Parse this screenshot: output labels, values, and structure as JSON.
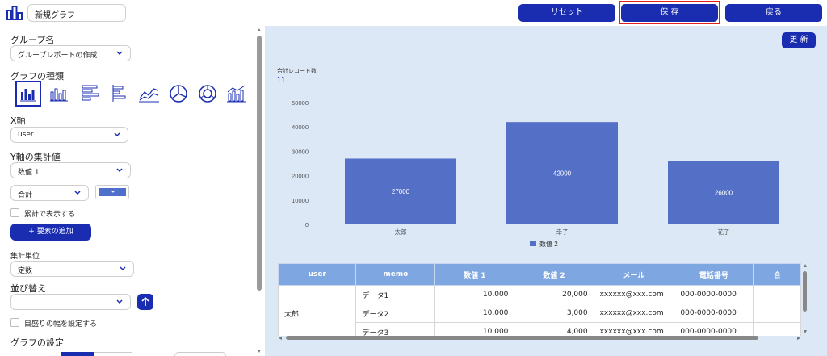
{
  "header": {
    "title_value": "新規グラフ",
    "reset_label": "リセット",
    "save_label": "保 存",
    "back_label": "戻る"
  },
  "sidebar": {
    "group_name_label": "グループ名",
    "group_select_value": "グループレポートの作成",
    "chart_type_label": "グラフの種類",
    "chart_types": [
      "bar-vertical-icon",
      "bar-vertical-thin-icon",
      "bar-horizontal-icon",
      "bar-horizontal-thin-icon",
      "line-chart-icon",
      "pie-chart-icon",
      "donut-chart-icon",
      "combo-chart-icon"
    ],
    "x_axis_label": "X軸",
    "x_axis_value": "user",
    "y_agg_label": "Y軸の集計値",
    "y_agg_value": "数値 1",
    "agg_func_value": "合計",
    "series_color": "#4f6fcb",
    "cumulative_label": "累計で表示する",
    "add_element_label": "+ 要素の追加",
    "unit_label": "集計単位",
    "unit_value": "定数",
    "sort_label": "並び替え",
    "sort_value": "",
    "tick_width_label": "目盛りの幅を設定する",
    "chart_settings_label": "グラフの設定"
  },
  "main": {
    "refresh_label": "更 新",
    "total_records_label": "合計レコード数",
    "total_records_value": "11"
  },
  "chart_data": {
    "type": "bar",
    "categories": [
      "太郎",
      "幸子",
      "花子"
    ],
    "series": [
      {
        "name": "数値 2",
        "values": [
          27000,
          42000,
          26000
        ]
      }
    ],
    "data_labels": [
      "27000",
      "42000",
      "26000"
    ],
    "yticks": [
      "50000",
      "40000",
      "30000",
      "20000",
      "10000",
      "0"
    ],
    "ylim": [
      0,
      50000
    ],
    "color": "#5470c6"
  },
  "table": {
    "headers": [
      "user",
      "memo",
      "数値 1",
      "数値 2",
      "メール",
      "電話番号",
      "合"
    ],
    "group_user": "太郎",
    "rows": [
      [
        "データ1",
        "10,000",
        "20,000",
        "xxxxxx@xxx.com",
        "000-0000-0000"
      ],
      [
        "データ2",
        "10,000",
        "3,000",
        "xxxxxx@xxx.com",
        "000-0000-0000"
      ],
      [
        "データ3",
        "10,000",
        "4,000",
        "xxxxxx@xxx.com",
        "000-0000-0000"
      ]
    ]
  }
}
